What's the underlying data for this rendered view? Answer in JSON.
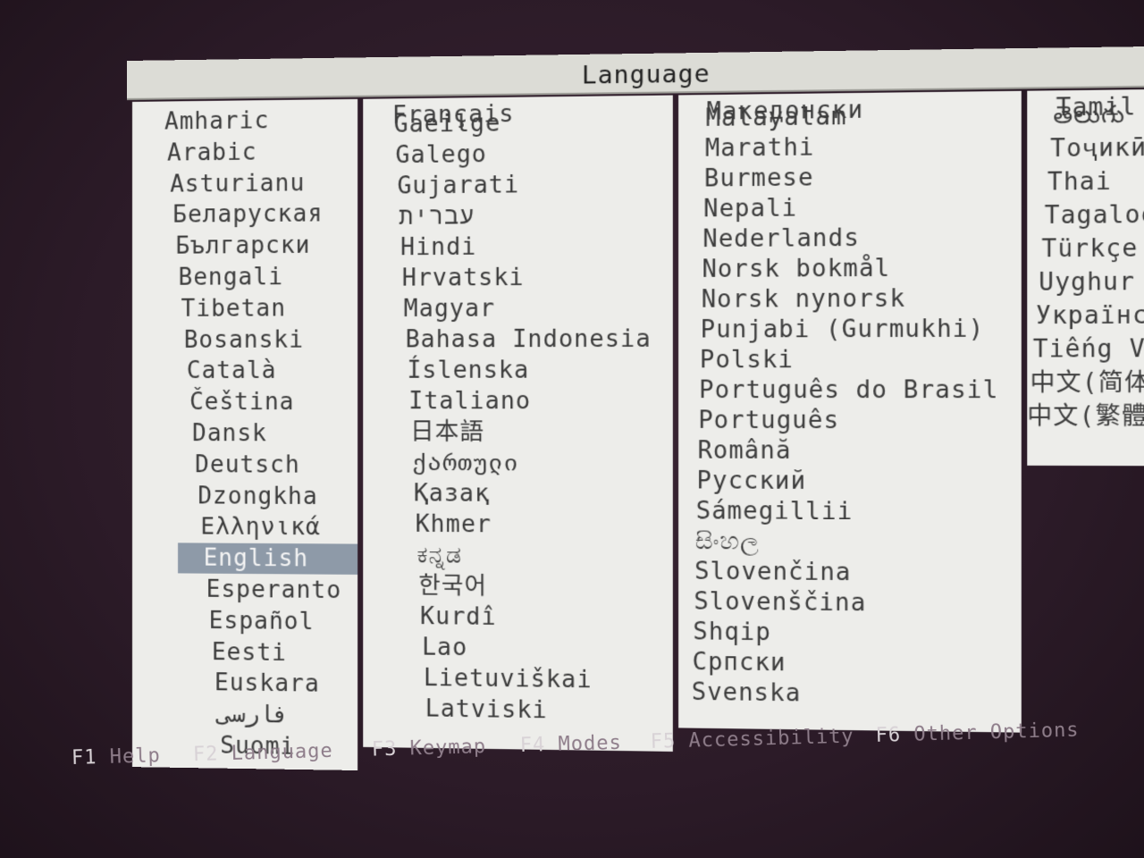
{
  "title": "Language",
  "selected": "English",
  "columns": [
    [
      "Amharic",
      "Arabic",
      "Asturianu",
      "Беларуская",
      "Български",
      "Bengali",
      "Tibetan",
      "Bosanski",
      "Català",
      "Čeština",
      "Dansk",
      "Deutsch",
      "Dzongkha",
      "Ελληνικά",
      "English",
      "Esperanto",
      "Español",
      "Eesti",
      "Euskara",
      "فارسی",
      "Suomi"
    ],
    [
      "Français",
      "Gaeilge",
      "Galego",
      "Gujarati",
      "עברית",
      "Hindi",
      "Hrvatski",
      "Magyar",
      "Bahasa Indonesia",
      "Íslenska",
      "Italiano",
      "日本語",
      "ქართული",
      "Қазақ",
      "Khmer",
      "ಕನ್ನಡ",
      "한국어",
      "Kurdî",
      "Lao",
      "Lietuviškai",
      "Latviski"
    ],
    [
      "Македонски",
      "Malayalam",
      "Marathi",
      "Burmese",
      "Nepali",
      "Nederlands",
      "Norsk bokmål",
      "Norsk nynorsk",
      "Punjabi (Gurmukhi)",
      "Polski",
      "Português do Brasil",
      "Português",
      "Română",
      "Русский",
      "Sámegillii",
      "සිංහල",
      "Slovenčina",
      "Slovenščina",
      "Shqip",
      "Српски",
      "Svenska"
    ],
    [
      "Tamil",
      "తెలుగు",
      "Тоҷикӣ",
      "Thai",
      "Tagalog",
      "Türkçe",
      "Uyghur",
      "Українська",
      "Tiếng Việt",
      "中文(简体)",
      "中文(繁體)"
    ]
  ],
  "function_keys": [
    {
      "key": "F1",
      "label": "Help"
    },
    {
      "key": "F2",
      "label": "Language"
    },
    {
      "key": "F3",
      "label": "Keymap"
    },
    {
      "key": "F4",
      "label": "Modes"
    },
    {
      "key": "F5",
      "label": "Accessibility"
    },
    {
      "key": "F6",
      "label": "Other Options"
    }
  ],
  "colors": {
    "panel": "#ededea",
    "selection": "#8e9aa8",
    "background": "#2c1b28"
  }
}
